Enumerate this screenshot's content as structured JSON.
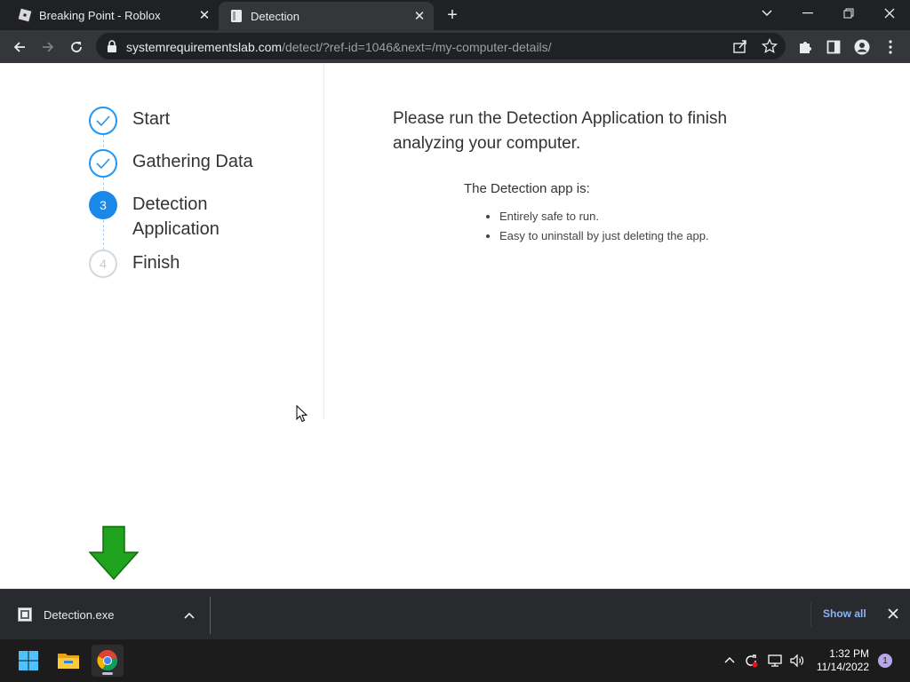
{
  "browser": {
    "tabs": [
      {
        "title": "Breaking Point - Roblox",
        "favicon": "roblox-icon",
        "active": false
      },
      {
        "title": "Detection",
        "favicon": "document-icon",
        "active": true
      }
    ],
    "url_host": "systemrequirementslab.com",
    "url_path": "/detect/?ref-id=1046&next=/my-computer-details/"
  },
  "steps": [
    {
      "number": "1",
      "label": "Start",
      "state": "done"
    },
    {
      "number": "2",
      "label": "Gathering Data",
      "state": "done"
    },
    {
      "number": "3",
      "label": "Detection Application",
      "state": "active"
    },
    {
      "number": "4",
      "label": "Finish",
      "state": "todo"
    }
  ],
  "main": {
    "headline": "Please run the Detection Application to finish analyzing your computer.",
    "app_title": "The Detection app is:",
    "bullets": [
      "Entirely safe to run.",
      "Easy to uninstall by just deleting the app."
    ]
  },
  "downloads": {
    "file_name": "Detection.exe",
    "show_all": "Show all"
  },
  "taskbar": {
    "time": "1:32 PM",
    "date": "11/14/2022",
    "notification_count": "1"
  },
  "colors": {
    "accent_blue": "#1a88e8",
    "arrow_green": "#1fa31f",
    "link_blue": "#8ab4f8"
  }
}
